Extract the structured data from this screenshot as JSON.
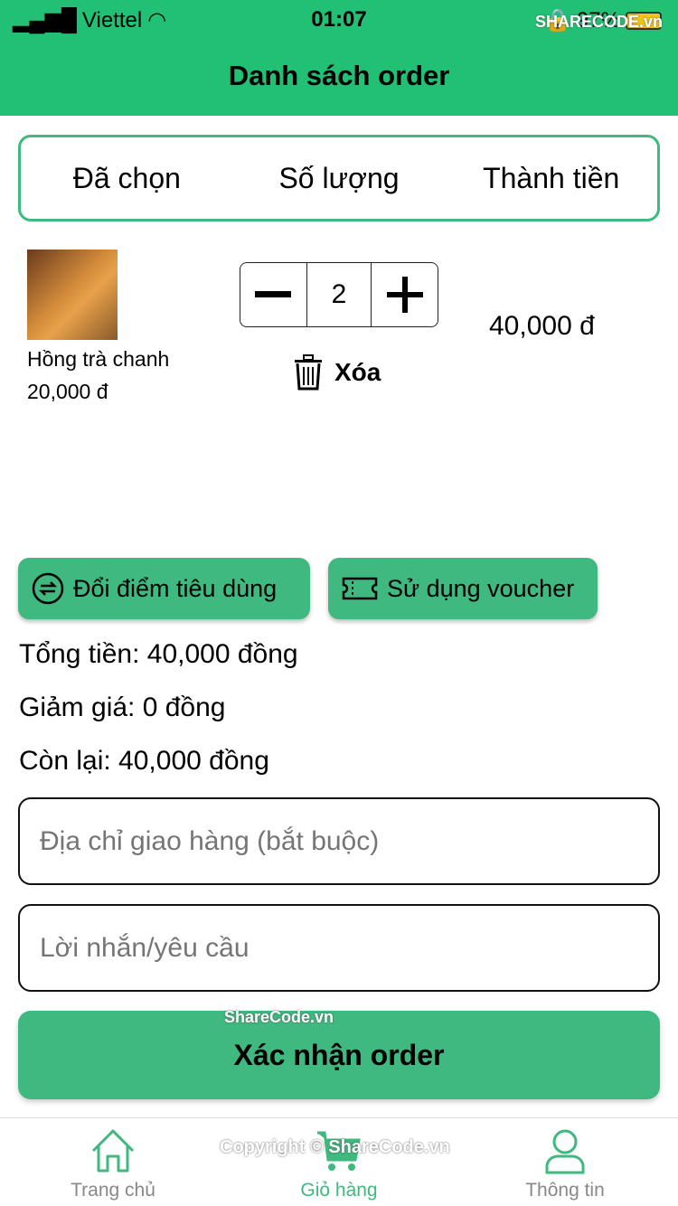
{
  "status": {
    "carrier": "Viettel",
    "time": "01:07",
    "battery": "97%"
  },
  "header": {
    "title": "Danh sách order"
  },
  "columns": [
    "Đã chọn",
    "Số lượng",
    "Thành tiền"
  ],
  "items": [
    {
      "name": "Hồng trà chanh",
      "price": "20,000 đ",
      "quantity": "2",
      "total": "40,000 đ",
      "delete_label": "Xóa"
    }
  ],
  "actions": {
    "points": "Đổi điểm tiêu dùng",
    "voucher": "Sử dụng voucher"
  },
  "summary": {
    "total": "Tổng tiền: 40,000 đồng",
    "discount": "Giảm giá: 0 đồng",
    "remaining": "Còn lại: 40,000 đồng"
  },
  "form": {
    "address_placeholder": "Địa chỉ giao hàng (bắt buộc)",
    "note_placeholder": "Lời nhắn/yêu cầu"
  },
  "confirm_label": "Xác nhận order",
  "tabs": [
    {
      "label": "Trang chủ",
      "icon": "home-icon"
    },
    {
      "label": "Giỏ hàng",
      "icon": "cart-icon",
      "active": true
    },
    {
      "label": "Thông tin",
      "icon": "user-icon"
    }
  ],
  "watermarks": {
    "logo": "SHARECODE.vn",
    "mid": "ShareCode.vn",
    "bottom": "Copyright © ShareCode.vn"
  },
  "colors": {
    "header": "#22c074",
    "accent": "#3fb97f"
  }
}
